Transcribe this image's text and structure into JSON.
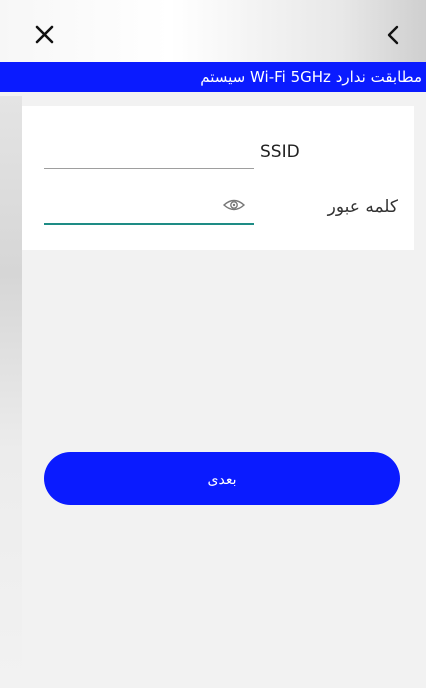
{
  "header": {
    "close_icon": "close-icon",
    "back_icon": "chevron-left-icon"
  },
  "banner": {
    "text": "سیستم Wi-Fi 5GHz مطابقت ندارد",
    "color": "#0a1bff"
  },
  "form": {
    "ssid_label": "SSID",
    "ssid_value": "",
    "password_label": "کلمه عبور",
    "password_value": "",
    "show_password_icon": "eye-icon",
    "focus_color": "#1e8c85"
  },
  "actions": {
    "next_label": "بعدی",
    "accent": "#0a1bff"
  }
}
